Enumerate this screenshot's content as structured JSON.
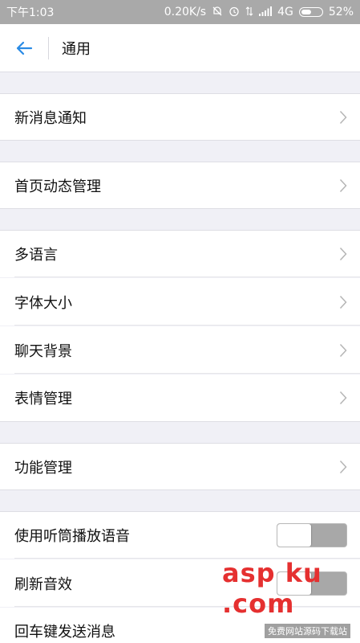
{
  "status_bar": {
    "time": "下午1:03",
    "net_speed": "0.20K/s",
    "network": "4G",
    "battery": "52%",
    "battery_level": 0.52,
    "icons": [
      "mute-icon",
      "alarm-icon",
      "data-arrows-icon",
      "signal-icon"
    ]
  },
  "header": {
    "title": "通用",
    "back_icon": "back-arrow-icon",
    "accent_color": "#2a8be5"
  },
  "settings": [
    {
      "label": "新消息通知",
      "control": "chevron"
    },
    {
      "label": "首页动态管理",
      "control": "chevron"
    },
    {
      "label": "多语言",
      "control": "chevron"
    },
    {
      "label": "字体大小",
      "control": "chevron"
    },
    {
      "label": "聊天背景",
      "control": "chevron"
    },
    {
      "label": "表情管理",
      "control": "chevron"
    },
    {
      "label": "功能管理",
      "control": "chevron"
    },
    {
      "label": "使用听筒播放语音",
      "control": "toggle",
      "on": false
    },
    {
      "label": "刷新音效",
      "control": "toggle",
      "on": false
    },
    {
      "label": "回车键发送消息",
      "control": "toggle"
    }
  ],
  "watermark": {
    "text": "asp ku .com",
    "subtext": "免费网站源码下载站"
  }
}
